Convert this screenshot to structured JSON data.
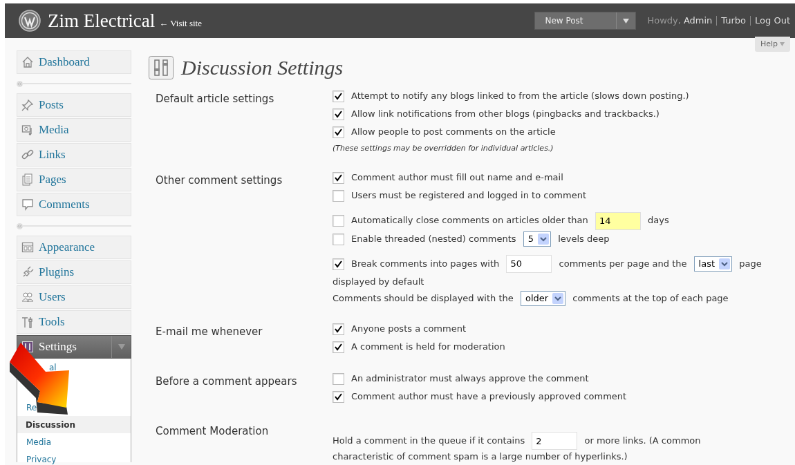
{
  "header": {
    "site_title": "Zim Electrical",
    "visit_link": "← Visit site",
    "new_post_button": "New Post",
    "greeting": "Howdy,",
    "user_link": "Admin",
    "links": [
      "Turbo",
      "Log Out"
    ]
  },
  "sidebar": {
    "groups": [
      [
        {
          "label": "Dashboard",
          "selected": false
        }
      ],
      [
        {
          "label": "Posts",
          "selected": false
        },
        {
          "label": "Media",
          "selected": false
        },
        {
          "label": "Links",
          "selected": false
        },
        {
          "label": "Pages",
          "selected": false
        },
        {
          "label": "Comments",
          "selected": false
        }
      ],
      [
        {
          "label": "Appearance",
          "selected": false
        },
        {
          "label": "Plugins",
          "selected": false
        },
        {
          "label": "Users",
          "selected": false
        },
        {
          "label": "Tools",
          "selected": false
        },
        {
          "label": "Settings",
          "selected": true,
          "children": [
            {
              "label": "al",
              "selected": false
            },
            {
              "label": "Re",
              "selected": false
            },
            {
              "label": "Discussion",
              "selected": true
            },
            {
              "label": "Media",
              "selected": false
            },
            {
              "label": "Privacy",
              "selected": false
            }
          ]
        }
      ]
    ]
  },
  "main": {
    "title": "Discussion Settings",
    "help_button": "Help",
    "sections": [
      {
        "label": "Default article settings",
        "rows": [
          {
            "kind": "checkbox",
            "checked": true,
            "parts": [
              {
                "kind": "text",
                "text": "Attempt to notify any blogs linked to from the article (slows down posting.)"
              }
            ]
          },
          {
            "kind": "checkbox",
            "checked": true,
            "parts": [
              {
                "kind": "text",
                "text": "Allow link notifications from other blogs (pingbacks and trackbacks.)"
              }
            ]
          },
          {
            "kind": "checkbox",
            "checked": true,
            "parts": [
              {
                "kind": "text",
                "text": "Allow people to post comments on the article"
              }
            ]
          },
          {
            "kind": "note",
            "parts": [
              {
                "kind": "text",
                "text": "(These settings may be overridden for individual articles.)"
              }
            ]
          }
        ]
      },
      {
        "label": "Other comment settings",
        "rows": [
          {
            "kind": "checkbox",
            "checked": true,
            "parts": [
              {
                "kind": "text",
                "text": "Comment author must fill out name and e-mail"
              }
            ]
          },
          {
            "kind": "checkbox",
            "checked": false,
            "parts": [
              {
                "kind": "text",
                "text": "Users must be registered and logged in to comment"
              }
            ]
          },
          {
            "kind": "checkbox",
            "checked": false,
            "parts": [
              {
                "kind": "text",
                "text": "Automatically close comments on articles older than"
              },
              {
                "kind": "input",
                "value": "14",
                "highlighted": true
              },
              {
                "kind": "text",
                "text": "days"
              }
            ]
          },
          {
            "kind": "checkbox",
            "checked": false,
            "parts": [
              {
                "kind": "text",
                "text": "Enable threaded (nested) comments"
              },
              {
                "kind": "select",
                "value": "5"
              },
              {
                "kind": "text",
                "text": "levels deep"
              }
            ]
          },
          {
            "kind": "checkbox",
            "checked": true,
            "parts": [
              {
                "kind": "text",
                "text": "Break comments into pages with"
              },
              {
                "kind": "input",
                "value": "50",
                "highlighted": false
              },
              {
                "kind": "text",
                "text": "comments per page and the"
              },
              {
                "kind": "select",
                "value": "last"
              },
              {
                "kind": "text",
                "text": "page"
              },
              {
                "kind": "text",
                "text": "displayed by default"
              }
            ]
          },
          {
            "kind": "text",
            "parts": [
              {
                "kind": "text",
                "text": "Comments should be displayed with the"
              },
              {
                "kind": "select",
                "value": "older"
              },
              {
                "kind": "text",
                "text": "comments at the top of each page"
              }
            ]
          }
        ]
      },
      {
        "label": "E-mail me whenever",
        "rows": [
          {
            "kind": "checkbox",
            "checked": true,
            "parts": [
              {
                "kind": "text",
                "text": "Anyone posts a comment"
              }
            ]
          },
          {
            "kind": "checkbox",
            "checked": true,
            "parts": [
              {
                "kind": "text",
                "text": "A comment is held for moderation"
              }
            ]
          }
        ]
      },
      {
        "label": "Before a comment appears",
        "rows": [
          {
            "kind": "checkbox",
            "checked": false,
            "parts": [
              {
                "kind": "text",
                "text": "An administrator must always approve the comment"
              }
            ]
          },
          {
            "kind": "checkbox",
            "checked": true,
            "parts": [
              {
                "kind": "text",
                "text": "Comment author must have a previously approved comment"
              }
            ]
          }
        ]
      },
      {
        "label": "Comment Moderation",
        "rows": [
          {
            "kind": "text",
            "parts": [
              {
                "kind": "text",
                "text": "Hold a comment in the queue if it contains"
              },
              {
                "kind": "input",
                "value": "2",
                "highlighted": false
              },
              {
                "kind": "text",
                "text": "or more links. (A common"
              },
              {
                "kind": "text",
                "text": "characteristic of comment spam is a large number of hyperlinks.)"
              }
            ]
          }
        ]
      }
    ]
  }
}
